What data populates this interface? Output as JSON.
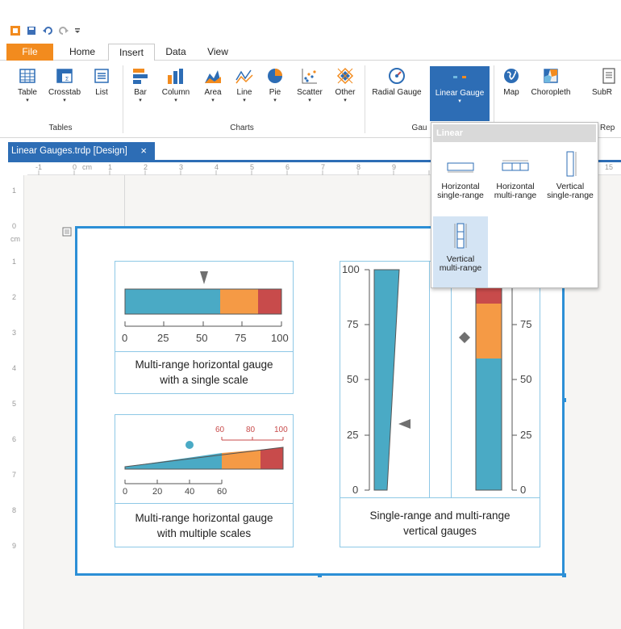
{
  "tabs": {
    "file": "File",
    "home": "Home",
    "insert": "Insert",
    "data": "Data",
    "view": "View"
  },
  "ribbon": {
    "table": "Table",
    "crosstab": "Crosstab",
    "list": "List",
    "tables_group": "Tables",
    "bar": "Bar",
    "column": "Column",
    "area": "Area",
    "line": "Line",
    "pie": "Pie",
    "scatter": "Scatter",
    "other": "Other",
    "charts_group": "Charts",
    "radial_gauge": "Radial Gauge",
    "linear_gauge": "Linear Gauge",
    "gauges_group": "Gau",
    "map": "Map",
    "choropleth": "Choropleth",
    "subreport": "SubR",
    "rep_group": "Rep"
  },
  "document": {
    "tab_title": "Linear Gauges.trdp [Design]",
    "close": "×"
  },
  "ruler": {
    "h": [
      "-1",
      "0",
      "cm",
      "1",
      "2",
      "3",
      "4",
      "5",
      "6",
      "7",
      "8",
      "9",
      "15"
    ],
    "v": [
      "1",
      "0",
      "cm",
      "1",
      "2",
      "3",
      "4",
      "5",
      "6",
      "7",
      "8",
      "9"
    ]
  },
  "dropdown": {
    "header": "Linear",
    "items": [
      {
        "line1": "Horizontal",
        "line2": "single-range"
      },
      {
        "line1": "Horizontal",
        "line2": "multi-range"
      },
      {
        "line1": "Vertical",
        "line2": "single-range"
      },
      {
        "line1": "Vertical",
        "line2": "multi-range"
      }
    ]
  },
  "gauges": {
    "hsingle": {
      "ticks": [
        "0",
        "25",
        "50",
        "75",
        "100"
      ],
      "caption1": "Multi-range horizontal gauge",
      "caption2": "with a single scale",
      "pointer_value": 50,
      "ranges": [
        60,
        85,
        100
      ]
    },
    "hmulti": {
      "ticks_main": [
        "0",
        "20",
        "40",
        "60"
      ],
      "ticks_sub": [
        "60",
        "80",
        "100"
      ],
      "caption1": "Multi-range horizontal gauge",
      "caption2": "with multiple scales",
      "pointer_value": 40
    },
    "vertical": {
      "left_ticks": [
        "100",
        "75",
        "50",
        "25",
        "0"
      ],
      "right_ticks": [
        "75",
        "50",
        "25",
        "0"
      ],
      "caption1": "Single-range and multi-range",
      "caption2": "vertical gauges",
      "single_pointer_value": 30,
      "multi_pointer_value": 80
    }
  },
  "colors": {
    "accent": "#2d6db5",
    "file_tab": "#f28b1e",
    "teal": "#4aaac5",
    "orange": "#f59a45",
    "red": "#c84b4b",
    "page_border": "#2c8fd6"
  }
}
